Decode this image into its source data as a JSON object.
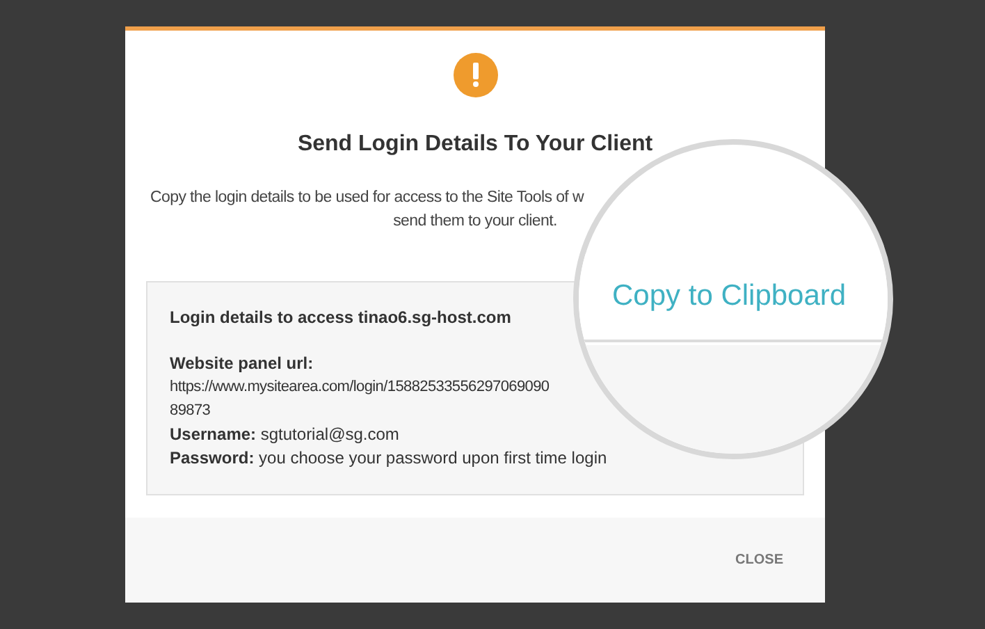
{
  "dialog": {
    "title": "Send Login Details To Your Client",
    "description": [
      "Copy the login details to be used for access to the Site Tools of w",
      "send them to your client."
    ],
    "details": {
      "heading": "Login details to access tinao6.sg-host.com",
      "url_label": "Website panel url:",
      "url_lines": [
        "https://www.mysitearea.com/login/15882533556297069090",
        "89873"
      ],
      "fields": [
        {
          "label": "Username:",
          "value": "sgtutorial@sg.com"
        },
        {
          "label": "Password:",
          "value": "you choose your password upon first time login"
        }
      ]
    },
    "magnifier": {
      "button": "Copy to Clipboard"
    },
    "buttons": [
      "CLOSE"
    ]
  }
}
